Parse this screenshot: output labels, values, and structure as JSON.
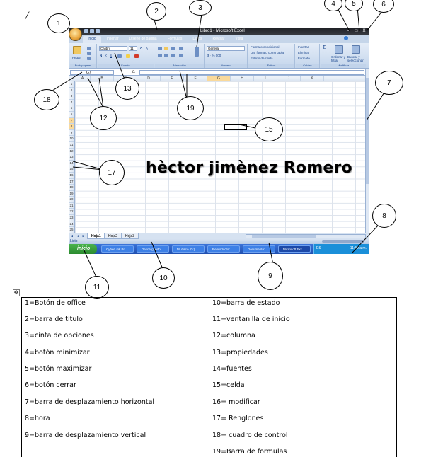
{
  "page_mark": "/",
  "excel": {
    "title": "Libro1 - Microsoft Excel",
    "window_buttons": [
      "–",
      "□",
      "X"
    ],
    "tabs": [
      "Inicio",
      "Insertar",
      "Diseño de página",
      "Fórmulas",
      "Datos",
      "Revisar",
      "Vista"
    ],
    "ribbon": {
      "clipboard": {
        "paste_label": "Pegar",
        "group": "Portapapeles"
      },
      "font": {
        "family": "Calibri",
        "size": "11",
        "bold": "N",
        "italic": "K",
        "underline": "S",
        "grow": "A",
        "shrink": "A",
        "group": "Fuente"
      },
      "alignment": {
        "group": "Alineación"
      },
      "number": {
        "format": "General",
        "group": "Número",
        "currency": "$ · % 000"
      },
      "styles": {
        "conditional": "Formato condicional",
        "table": "Dar formato como tabla",
        "cell": "Estilos de celda",
        "group": "Estilos"
      },
      "cells": {
        "insert": "Insertar",
        "delete": "Eliminar",
        "format": "Formato",
        "group": "Celdas"
      },
      "editing": {
        "sort": "Ordenar y filtrar",
        "find": "Buscar y seleccionar",
        "sigma": "Σ",
        "group": "Modificar"
      }
    },
    "formula_bar": {
      "name_box": "G7",
      "fx": "fx"
    },
    "columns": [
      "A",
      "B",
      "C",
      "D",
      "E",
      "F",
      "G",
      "H",
      "I",
      "J",
      "K",
      "L"
    ],
    "selected_column": "G",
    "rows": [
      "1",
      "2",
      "3",
      "4",
      "5",
      "6",
      "7",
      "8",
      "9",
      "10",
      "11",
      "12",
      "13",
      "14",
      "15",
      "16",
      "17",
      "18",
      "19",
      "20",
      "21",
      "22",
      "23",
      "24",
      "25"
    ],
    "selected_rows": [
      "7",
      "8"
    ],
    "overlay_text": "hèctor jimènez Romero",
    "sheet_nav": "◄ ◄ ► ►",
    "sheet_tabs": [
      "Hoja1",
      "Hoja2",
      "Hoja3"
    ],
    "status": "Listo",
    "taskbar": {
      "start": "inicio",
      "tasks": [
        "CyberLink Po...",
        "Descargando...",
        "Mi disco (D:)",
        "Reproductor ...",
        "Documento1 ...",
        "Microsoft Exc..."
      ],
      "active_task": "Microsoft Exc...",
      "tray_lang": "ES",
      "clock": "11:59 a.m."
    }
  },
  "callouts": [
    "1",
    "2",
    "3",
    "4",
    "5",
    "6",
    "7",
    "8",
    "9",
    "10",
    "11",
    "12",
    "13",
    "15",
    "17",
    "18",
    "19"
  ],
  "legend": {
    "left": [
      "1=Botón de office",
      "2=barra de titulo",
      "3=cinta de opciones",
      "4=botón minimizar",
      "5=botón maximizar",
      "6=botón cerrar",
      "7=barra de desplazamiento horizontal",
      "8=hora",
      "9=barra de desplazamiento vertical"
    ],
    "right": [
      "10=barra de estado",
      "11=ventanilla de inicio",
      "12=columna",
      "13=propiedades",
      "14=fuentes",
      "15=celda",
      "16= modificar",
      "17= Renglones",
      "18= cuadro de control",
      "19=Barra de formulas"
    ]
  }
}
